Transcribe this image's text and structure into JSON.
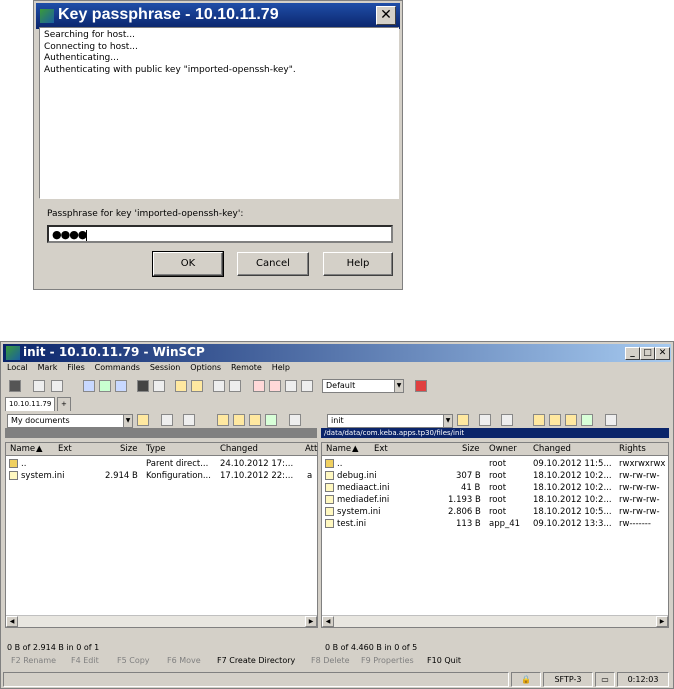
{
  "dialog": {
    "title": "Key passphrase - 10.10.11.79",
    "log": [
      "Searching for host...",
      "Connecting to host...",
      "Authenticating...",
      "Authenticating with public key \"imported-openssh-key\"."
    ],
    "passphrase_label": "Passphrase for key 'imported-openssh-key':",
    "passphrase_value": "●●●●",
    "ok": "OK",
    "cancel": "Cancel",
    "help": "Help"
  },
  "window": {
    "title": "init - 10.10.11.79 - WinSCP",
    "menu": [
      "Local",
      "Mark",
      "Files",
      "Commands",
      "Session",
      "Options",
      "Remote",
      "Help"
    ],
    "transfer_setting": "Default",
    "tabs": [
      "10.10.11.79",
      "+"
    ]
  },
  "left": {
    "path": "My documents",
    "columns": [
      "Name",
      "Ext",
      "Size",
      "Type",
      "Changed",
      "Att"
    ],
    "rows": [
      {
        "name": "..",
        "size": "",
        "type": "Parent direct...",
        "changed": "24.10.2012  17:...",
        "attr": ""
      },
      {
        "name": "system.ini",
        "size": "2.914 B",
        "type": "Konfiguration...",
        "changed": "17.10.2012  22:...",
        "attr": "a"
      }
    ],
    "status": "0 B of 2.914 B in 0 of 1"
  },
  "right": {
    "path": "init",
    "full_path": "/data/data/com.keba.apps.tp30/files/init",
    "columns": [
      "Name",
      "Ext",
      "Size",
      "Owner",
      "Changed",
      "Rights"
    ],
    "rows": [
      {
        "name": "..",
        "size": "",
        "owner": "root",
        "changed": "09.10.2012  11:5...",
        "rights": "rwxrwxrwx"
      },
      {
        "name": "debug.ini",
        "size": "307 B",
        "owner": "root",
        "changed": "18.10.2012  10:2...",
        "rights": "rw-rw-rw-"
      },
      {
        "name": "mediaact.ini",
        "size": "41 B",
        "owner": "root",
        "changed": "18.10.2012  10:2...",
        "rights": "rw-rw-rw-"
      },
      {
        "name": "mediadef.ini",
        "size": "1.193 B",
        "owner": "root",
        "changed": "18.10.2012  10:2...",
        "rights": "rw-rw-rw-"
      },
      {
        "name": "system.ini",
        "size": "2.806 B",
        "owner": "root",
        "changed": "18.10.2012  10:5...",
        "rights": "rw-rw-rw-"
      },
      {
        "name": "test.ini",
        "size": "113 B",
        "owner": "app_41",
        "changed": "09.10.2012  13:3...",
        "rights": "rw-------"
      }
    ],
    "status": "0 B of 4.460 B in 0 of 5"
  },
  "fkeys": [
    "F2 Rename",
    "F4 Edit",
    "F5 Copy",
    "F6 Move",
    "F7 Create Directory",
    "F8 Delete",
    "F9 Properties",
    "F10 Quit"
  ],
  "statusbar": {
    "protocol": "SFTP-3",
    "time": "0:12:03"
  }
}
